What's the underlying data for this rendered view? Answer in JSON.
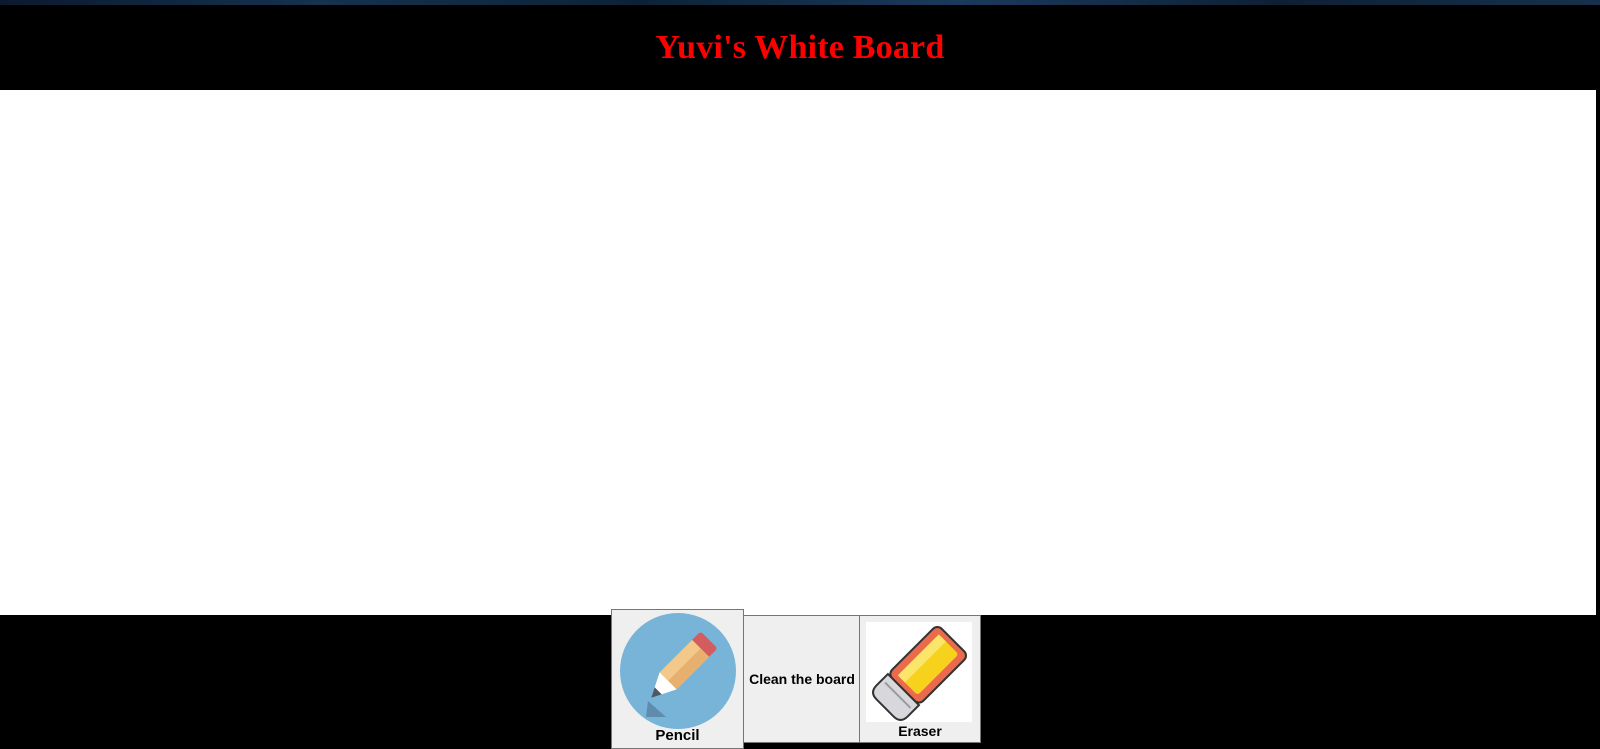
{
  "header": {
    "title": "Yuvi's White Board"
  },
  "toolbar": {
    "pencil": {
      "label": "Pencil",
      "icon": "pencil-icon"
    },
    "clean": {
      "label": "Clean the board"
    },
    "eraser": {
      "label": "Eraser",
      "icon": "eraser-icon"
    }
  },
  "colors": {
    "title": "#ff0000",
    "background": "#000000",
    "board": "#ffffff",
    "button_bg": "#efefef"
  }
}
